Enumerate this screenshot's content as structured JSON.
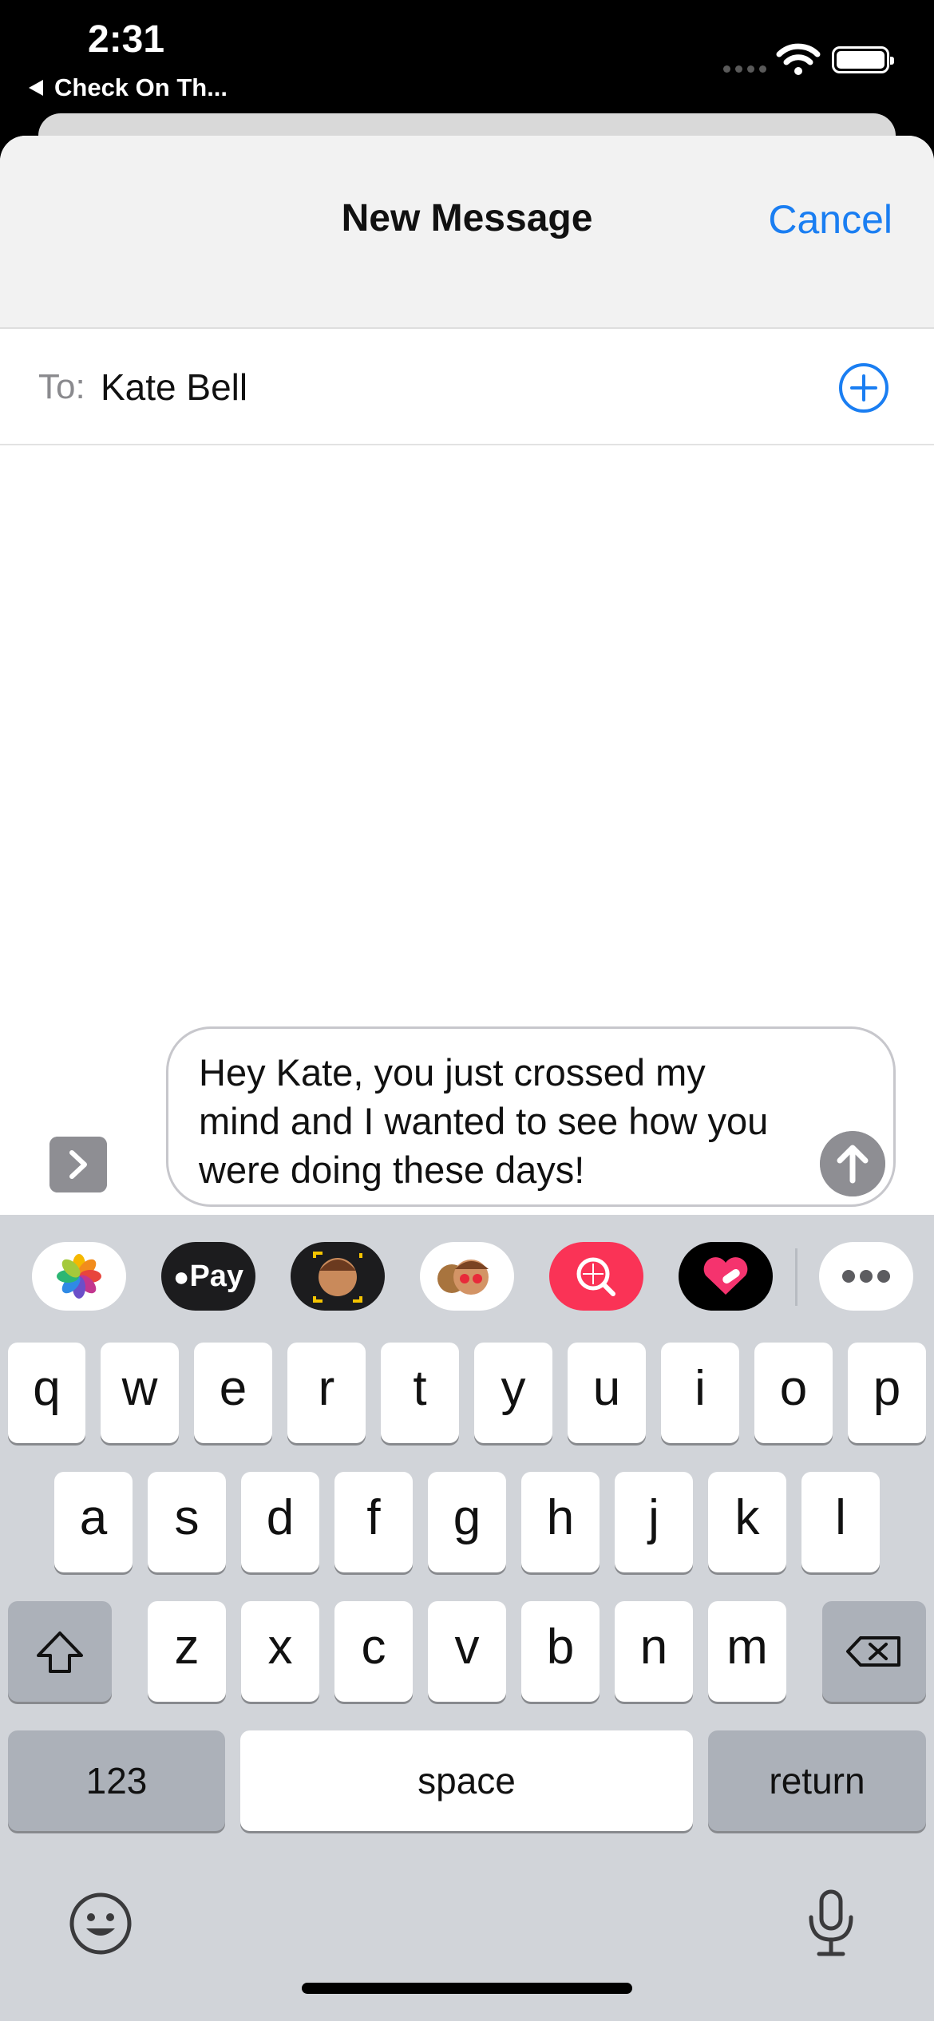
{
  "status_bar": {
    "time": "2:31",
    "back_app_label": "Check On Th..."
  },
  "nav": {
    "title": "New Message",
    "cancel_label": "Cancel"
  },
  "to_field": {
    "label": "To:",
    "recipient": "Kate Bell"
  },
  "composer": {
    "text": "Hey Kate, you just crossed my mind and I wanted to see how you were doing these days!"
  },
  "app_strip": [
    {
      "name": "photos-app-icon",
      "bg": "#ffffff"
    },
    {
      "name": "apple-pay-app-icon",
      "bg": "#1c1c1e",
      "label": "Pay"
    },
    {
      "name": "memoji-camera-app-icon",
      "bg": "#1c1c1e"
    },
    {
      "name": "memoji-stickers-app-icon",
      "bg": "#ffffff"
    },
    {
      "name": "image-search-app-icon",
      "bg": "#fa3356"
    },
    {
      "name": "digital-touch-app-icon",
      "bg": "#000000"
    },
    {
      "name": "more-apps-icon",
      "bg": "#ffffff"
    }
  ],
  "keyboard": {
    "row1": [
      "q",
      "w",
      "e",
      "r",
      "t",
      "y",
      "u",
      "i",
      "o",
      "p"
    ],
    "row2": [
      "a",
      "s",
      "d",
      "f",
      "g",
      "h",
      "j",
      "k",
      "l"
    ],
    "row3": [
      "z",
      "x",
      "c",
      "v",
      "b",
      "n",
      "m"
    ],
    "numbers_label": "123",
    "space_label": "space",
    "return_label": "return"
  },
  "colors": {
    "accent": "#1a7ef2",
    "keyboard_bg": "#d1d4d9",
    "dark_key": "#acb1b9"
  }
}
